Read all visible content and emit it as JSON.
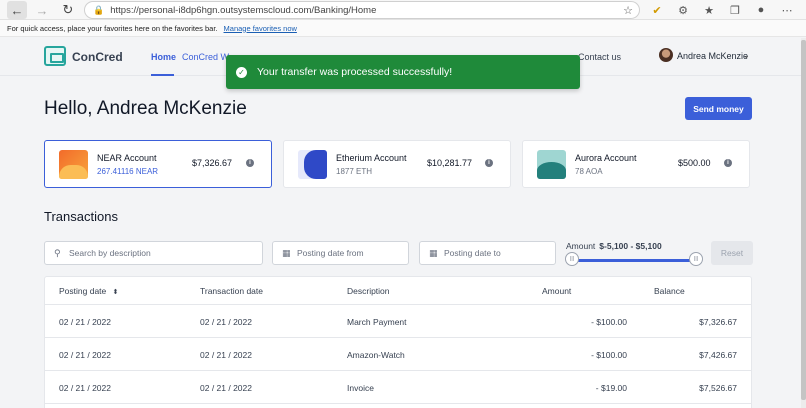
{
  "browser": {
    "url": "https://personal-i8dp6hgn.outsystemscloud.com/Banking/Home",
    "favorites_text": "For quick access, place your favorites here on the favorites bar.",
    "favorites_link": "Manage favorites now"
  },
  "header": {
    "brand": "ConCred",
    "tabs": [
      {
        "label": "Home"
      },
      {
        "label": "ConCred Wa"
      },
      {
        "label": "Contact us"
      }
    ],
    "user_name": "Andrea McKenzie"
  },
  "toast": {
    "message": "Your transfer was processed successfully!"
  },
  "main": {
    "greeting": "Hello, Andrea McKenzie",
    "send_money": "Send money",
    "accounts": [
      {
        "name": "NEAR Account",
        "sub": "267.41116 NEAR",
        "amount": "$7,326.67"
      },
      {
        "name": "Etherium Account",
        "sub": "1877 ETH",
        "amount": "$10,281.77"
      },
      {
        "name": "Aurora Account",
        "sub": "78 AOA",
        "amount": "$500.00"
      }
    ],
    "transactions_title": "Transactions",
    "filters": {
      "search_placeholder": "Search by description",
      "date_from": "Posting date from",
      "date_to": "Posting date to",
      "amount_label": "Amount",
      "amount_range": "$-5,100 - $5,100",
      "reset": "Reset"
    },
    "table": {
      "headers": [
        "Posting date",
        "Transaction date",
        "Description",
        "Amount",
        "Balance"
      ],
      "rows": [
        [
          "02 / 21 / 2022",
          "02 / 21 / 2022",
          "March Payment",
          "- $100.00",
          "$7,326.67"
        ],
        [
          "02 / 21 / 2022",
          "02 / 21 / 2022",
          "Amazon-Watch",
          "- $100.00",
          "$7,426.67"
        ],
        [
          "02 / 21 / 2022",
          "02 / 21 / 2022",
          "Invoice",
          "- $19.00",
          "$7,526.67"
        ]
      ]
    }
  }
}
